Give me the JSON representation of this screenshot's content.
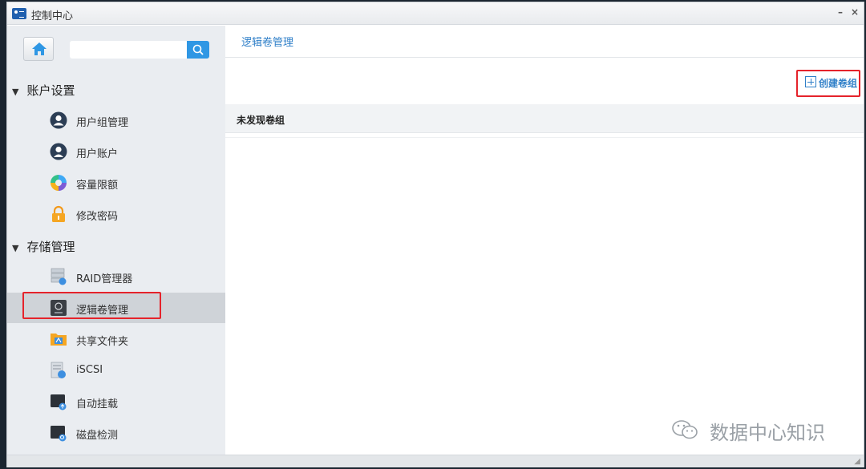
{
  "window": {
    "title": "控制中心",
    "minimize_label": "–",
    "close_label": "×"
  },
  "sidebar": {
    "search": {
      "placeholder": "",
      "value": ""
    },
    "sections": [
      {
        "label": "账户设置"
      },
      {
        "label": "存储管理"
      }
    ],
    "items": [
      {
        "label": "用户组管理",
        "icon": "user-group-icon"
      },
      {
        "label": "用户账户",
        "icon": "user-icon"
      },
      {
        "label": "容量限额",
        "icon": "quota-ring-icon"
      },
      {
        "label": "修改密码",
        "icon": "lock-icon"
      },
      {
        "label": "RAID管理器",
        "icon": "raid-icon"
      },
      {
        "label": "逻辑卷管理",
        "icon": "lvm-icon",
        "selected": true
      },
      {
        "label": "共享文件夹",
        "icon": "shared-folder-icon"
      },
      {
        "label": "iSCSI",
        "icon": "iscsi-icon"
      },
      {
        "label": "自动挂载",
        "icon": "automount-icon"
      },
      {
        "label": "磁盘检测",
        "icon": "disk-check-icon"
      }
    ]
  },
  "main": {
    "title": "逻辑卷管理",
    "create_label": "创建卷组",
    "empty_text": "未发现卷组"
  },
  "watermark": {
    "text": "数据中心知识"
  },
  "colors": {
    "accent": "#2f7fc8",
    "highlight": "#e5232b",
    "search_button": "#2f97e4"
  }
}
